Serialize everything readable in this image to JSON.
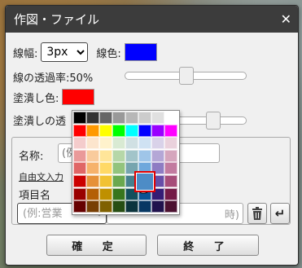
{
  "dialog": {
    "title": "作図・ファイル",
    "line_width_label": "線幅:",
    "line_width_value": "3px",
    "line_color_label": "線色:",
    "line_color": "#0000ff",
    "line_opacity_label": "線の透過率:50%",
    "line_opacity": 0.5,
    "fill_color_label": "塗潰し色:",
    "fill_color": "#ff0000",
    "fill_opacity_label": "塗潰しの透",
    "fill_opacity": 0.75,
    "name_label": "名称:",
    "name_placeholder": "(例",
    "free_input_label": "自由文入力",
    "item_name_label": "項目名",
    "item_placeholder": "(例:営業",
    "value_placeholder_tail": "時)",
    "confirm_button": "確 定",
    "end_button": "終 了"
  },
  "palette": {
    "selected": "#4d8cc6",
    "rows": [
      [
        "#000000",
        "#333333",
        "#666666",
        "#999999",
        "#b7b7b7",
        "#cccccc",
        "#e0e0e0",
        "#ffffff"
      ],
      [
        "#ff0000",
        "#ff9900",
        "#ffff00",
        "#00ff00",
        "#00ffff",
        "#0000ff",
        "#9900ff",
        "#ff00ff"
      ],
      [
        "#f4cccc",
        "#fce5cd",
        "#fff2cc",
        "#d9ead3",
        "#d0e0e3",
        "#cfe2f3",
        "#d9d2e9",
        "#ead1dc"
      ],
      [
        "#ea9999",
        "#f9cb9c",
        "#ffe599",
        "#b6d7a8",
        "#a2c4c9",
        "#9fc5e8",
        "#b4a7d6",
        "#d5a6bd"
      ],
      [
        "#e06666",
        "#f6b26b",
        "#ffd966",
        "#93c47d",
        "#76a5af",
        "#6fa8dc",
        "#8e7cc3",
        "#c27ba0"
      ],
      [
        "#cc0000",
        "#e69138",
        "#f1c232",
        "#6aa84f",
        "#45818e",
        "#4d8cc6",
        "#674ea7",
        "#a64d79"
      ],
      [
        "#990000",
        "#b45f06",
        "#bf9000",
        "#38761d",
        "#134f5c",
        "#0b5394",
        "#351c75",
        "#741b47"
      ],
      [
        "#660000",
        "#783f04",
        "#7f6000",
        "#274e13",
        "#0c343d",
        "#073763",
        "#20124d",
        "#4c1130"
      ]
    ]
  }
}
